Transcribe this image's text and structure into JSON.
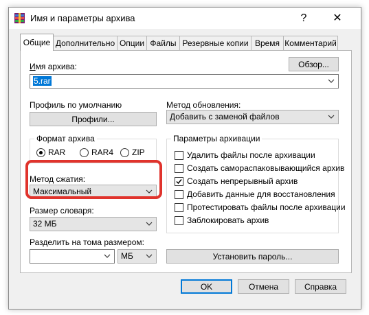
{
  "window": {
    "title": "Имя и параметры архива",
    "help_glyph": "?",
    "close_glyph": "✕"
  },
  "tabs": [
    {
      "label": "Общие",
      "active": true
    },
    {
      "label": "Дополнительно"
    },
    {
      "label": "Опции"
    },
    {
      "label": "Файлы"
    },
    {
      "label": "Резервные копии"
    },
    {
      "label": "Время"
    },
    {
      "label": "Комментарий"
    }
  ],
  "archive_name": {
    "label": "Имя архива:",
    "value": "5.rar",
    "browse_label": "Обзор..."
  },
  "profile": {
    "label": "Профиль по умолчанию",
    "button_label": "Профили..."
  },
  "update_method": {
    "label": "Метод обновления:",
    "value": "Добавить с заменой файлов"
  },
  "archive_format": {
    "label": "Формат архива",
    "options": [
      {
        "label": "RAR",
        "selected": true
      },
      {
        "label": "RAR4",
        "selected": false
      },
      {
        "label": "ZIP",
        "selected": false
      }
    ]
  },
  "compression": {
    "label": "Метод сжатия:",
    "value": "Максимальный",
    "highlight_color": "#e0332c"
  },
  "dictionary": {
    "label": "Размер словаря:",
    "value": "32 МБ"
  },
  "split": {
    "label": "Разделить на тома размером:",
    "value": "",
    "unit": "МБ"
  },
  "password_button": "Установить пароль...",
  "archive_options": {
    "label": "Параметры архивации",
    "items": [
      {
        "label": "Удалить файлы после архивации",
        "checked": false
      },
      {
        "label": "Создать самораспаковывающийся архив",
        "checked": false
      },
      {
        "label": "Создать непрерывный архив",
        "checked": true
      },
      {
        "label": "Добавить данные для восстановления",
        "checked": false
      },
      {
        "label": "Протестировать файлы после архивации",
        "checked": false
      },
      {
        "label": "Заблокировать архив",
        "checked": false
      }
    ]
  },
  "footer": {
    "ok": "OK",
    "cancel": "Отмена",
    "help": "Справка"
  },
  "colors": {
    "accent": "#0078d7",
    "window_bg": "#f0f0f0"
  }
}
